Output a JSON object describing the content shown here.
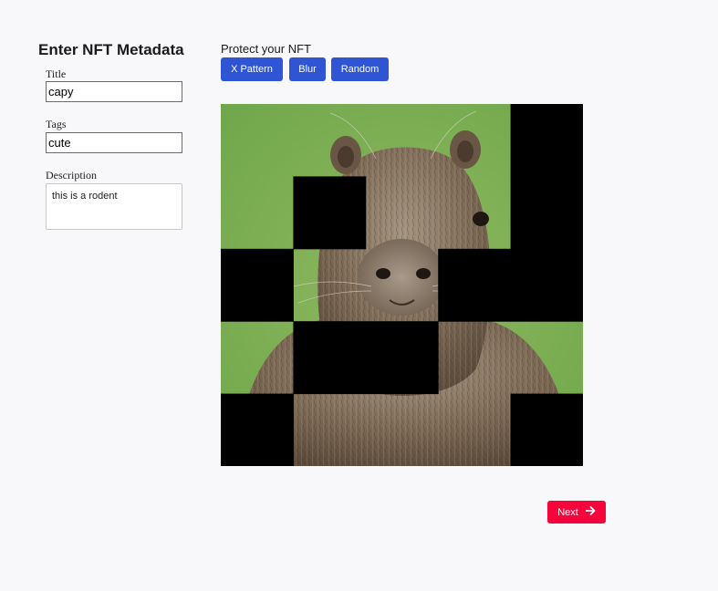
{
  "form": {
    "heading": "Enter NFT Metadata",
    "title_label": "Title",
    "title_value": "capy",
    "tags_label": "Tags",
    "tags_value": "cute",
    "description_label": "Description",
    "description_value": "this is a rodent"
  },
  "protect": {
    "label": "Protect your NFT",
    "buttons": [
      "X Pattern",
      "Blur",
      "Random"
    ]
  },
  "image": {
    "subject": "capybara",
    "grid": 5,
    "masked_cells": [
      [
        0,
        4
      ],
      [
        1,
        1
      ],
      [
        1,
        4
      ],
      [
        2,
        0
      ],
      [
        2,
        3
      ],
      [
        2,
        4
      ],
      [
        3,
        1
      ],
      [
        3,
        2
      ],
      [
        4,
        0
      ],
      [
        4,
        4
      ]
    ]
  },
  "next": {
    "label": "Next",
    "icon": "arrow-right-icon"
  },
  "colors": {
    "primary_button": "#2f55d4",
    "next_button": "#f5053c",
    "background": "#f8f8fa"
  }
}
